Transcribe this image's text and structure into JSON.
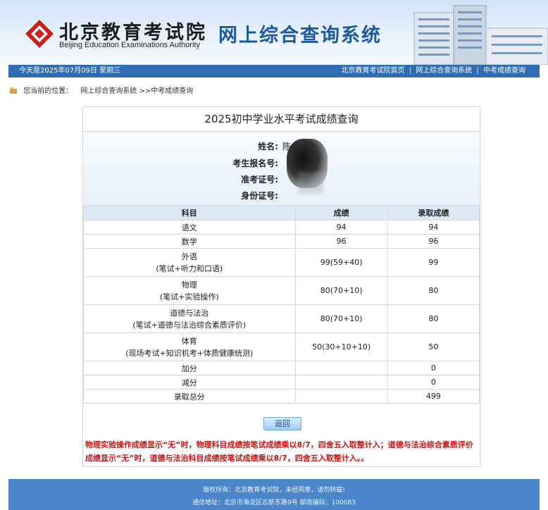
{
  "header": {
    "logo_cn": "北京教育考试院",
    "logo_en": "Beijing Education Examinations Authority",
    "system_title": "网上综合查询系统"
  },
  "topbar": {
    "date": "今天是2025年07月09日 星期三",
    "links": [
      "北京教育考试院首页",
      "网上综合查询系统",
      "中考成绩查询"
    ]
  },
  "breadcrumb": {
    "label": "您当前的位置：",
    "path": "网上综合查询系统 >>中考成绩查询"
  },
  "panel": {
    "title": "2025初中学业水平考试成绩查询",
    "info": {
      "name_label": "姓名:",
      "name_value": "陈",
      "reg_label": "考生报名号:",
      "reg_value": "",
      "ticket_label": "准考证号:",
      "ticket_value": "",
      "id_label": "身份证号:",
      "id_value": ""
    },
    "table": {
      "headers": [
        "科目",
        "成绩",
        "录取成绩"
      ],
      "rows": [
        {
          "subject": "语文",
          "subject_sub": "",
          "score": "94",
          "admit": "94"
        },
        {
          "subject": "数学",
          "subject_sub": "",
          "score": "96",
          "admit": "96"
        },
        {
          "subject": "外语",
          "subject_sub": "(笔试+听力和口语)",
          "score": "99(59+40)",
          "admit": "99"
        },
        {
          "subject": "物理",
          "subject_sub": "(笔试+实验操作)",
          "score": "80(70+10)",
          "admit": "80"
        },
        {
          "subject": "道德与法治",
          "subject_sub": "(笔试+道德与法治综合素质评价)",
          "score": "80(70+10)",
          "admit": "80"
        },
        {
          "subject": "体育",
          "subject_sub": "(现场考试+知识机考+体质健康统测)",
          "score": "50(30+10+10)",
          "admit": "50"
        },
        {
          "subject": "加分",
          "subject_sub": "",
          "score": "",
          "admit": "0"
        },
        {
          "subject": "减分",
          "subject_sub": "",
          "score": "",
          "admit": "0"
        },
        {
          "subject": "录取总分",
          "subject_sub": "",
          "score": "",
          "admit": "499"
        }
      ]
    },
    "back_button": "返回",
    "note": "物理实验操作成绩显示“无”时，物理科目成绩按笔试成绩乘以8/7，四舍五入取整计入；道德与法治综合素质评价成绩显示“无”时，道德与法治科目成绩按笔试成绩乘以8/7，四舍五入取整计入。。"
  },
  "footer": {
    "copyright": "版权所有：北京教育考试院，未经同意，请勿转载!",
    "address": "通信地址：北京市海淀区志新东路9号 邮政编码：100083"
  },
  "colors": {
    "accent_blue": "#2f6db5",
    "note_red": "#cc1111",
    "table_header_bg": "#dde9f7"
  }
}
